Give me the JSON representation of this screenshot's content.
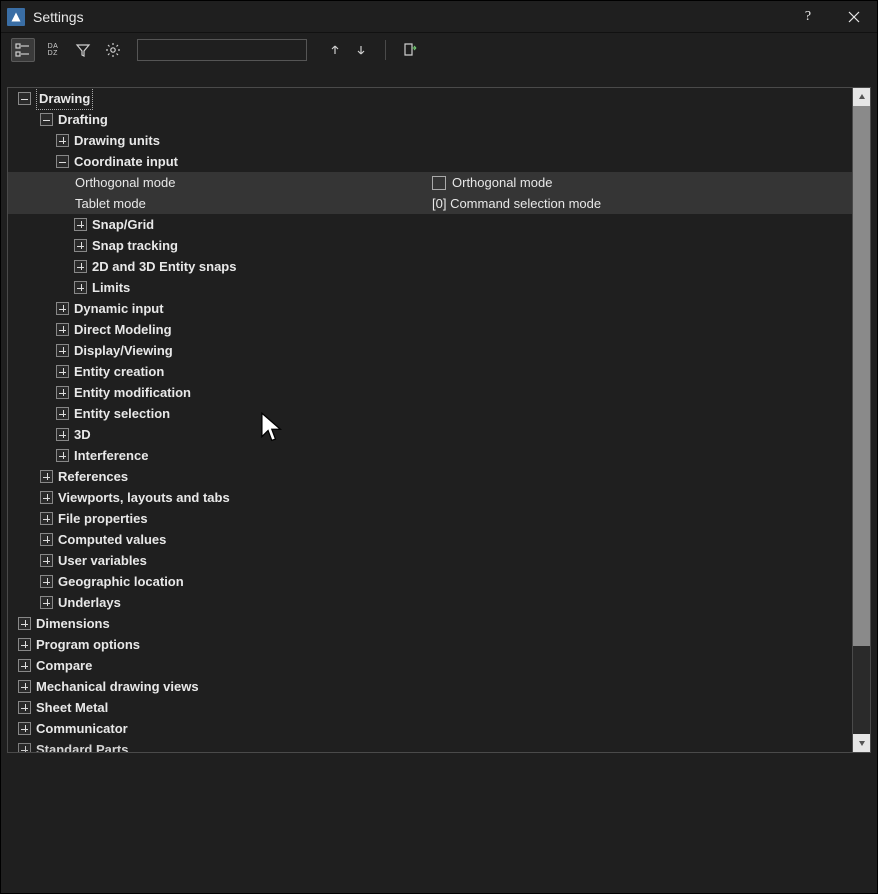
{
  "window": {
    "title": "Settings"
  },
  "toolbar": {
    "search_placeholder": ""
  },
  "tree": {
    "root": {
      "label": "Drawing",
      "children": {
        "drafting": {
          "label": "Drafting",
          "children": {
            "drawing_units": "Drawing units",
            "coord_input": {
              "label": "Coordinate input",
              "props": {
                "orthogonal": {
                  "name": "Orthogonal mode",
                  "value": "Orthogonal mode"
                },
                "tablet": {
                  "name": "Tablet mode",
                  "value": "[0] Command selection mode"
                }
              },
              "children": {
                "snap_grid": "Snap/Grid",
                "snap_tracking": "Snap tracking",
                "entity_snaps": "2D and 3D Entity snaps",
                "limits": "Limits"
              }
            },
            "dynamic_input": "Dynamic input",
            "direct_modeling": "Direct Modeling",
            "display_viewing": "Display/Viewing",
            "entity_creation": "Entity creation",
            "entity_modification": "Entity modification",
            "entity_selection": "Entity selection",
            "three_d": "3D",
            "interference": "Interference"
          }
        },
        "references": "References",
        "viewports": "Viewports, layouts and tabs",
        "file_props": "File properties",
        "computed": "Computed values",
        "user_vars": "User variables",
        "geo": "Geographic location",
        "underlays": "Underlays"
      }
    },
    "dimensions": "Dimensions",
    "program_options": "Program options",
    "compare": "Compare",
    "mech_views": "Mechanical drawing views",
    "sheet_metal": "Sheet Metal",
    "communicator": "Communicator",
    "standard_parts": "Standard Parts"
  }
}
